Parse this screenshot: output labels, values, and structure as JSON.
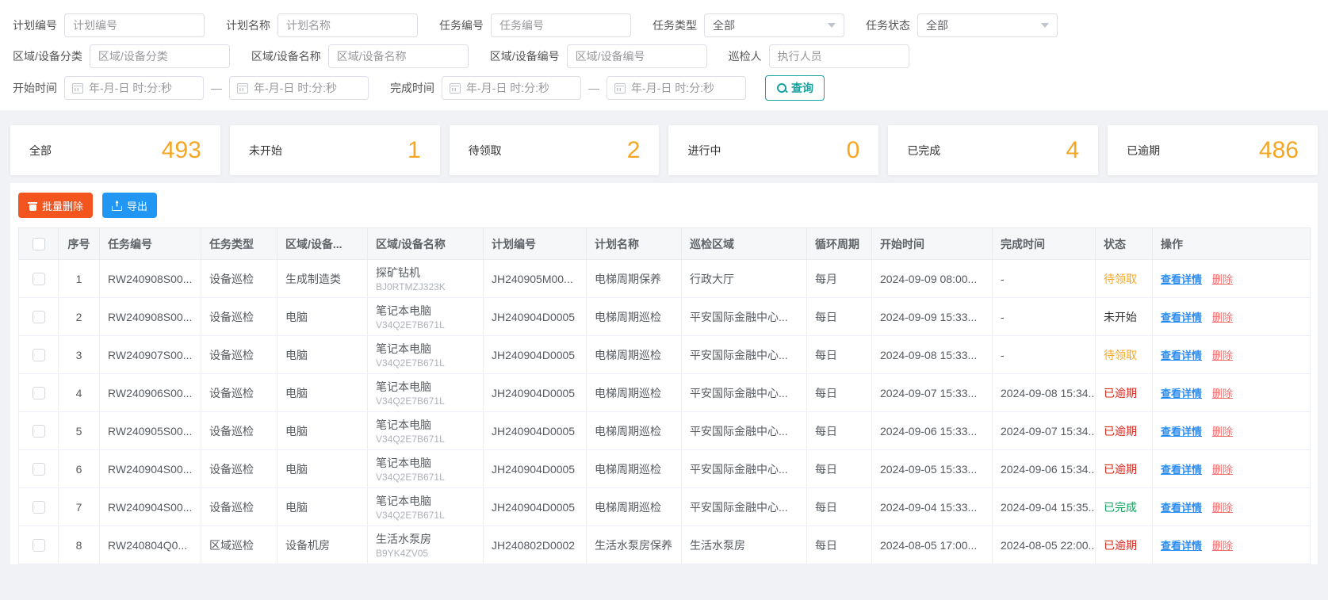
{
  "colors": {
    "accent_teal": "#18a1a0",
    "stat_number_orange": "#f5a623",
    "danger_button": "#f4541d",
    "primary_button": "#2196f3",
    "status_pending": "#f5a623",
    "status_overdue": "#d8281e",
    "status_done": "#11a35c",
    "link_blue": "#2d8cf0",
    "link_delete_red": "#f56c6c"
  },
  "filters": {
    "plan_no": {
      "label": "计划编号",
      "placeholder": "计划编号"
    },
    "plan_name": {
      "label": "计划名称",
      "placeholder": "计划名称"
    },
    "task_no": {
      "label": "任务编号",
      "placeholder": "任务编号"
    },
    "task_type": {
      "label": "任务类型",
      "value": "全部"
    },
    "task_status": {
      "label": "任务状态",
      "value": "全部"
    },
    "dev_cat": {
      "label": "区域/设备分类",
      "placeholder": "区域/设备分类"
    },
    "dev_name": {
      "label": "区域/设备名称",
      "placeholder": "区域/设备名称"
    },
    "dev_no": {
      "label": "区域/设备编号",
      "placeholder": "区域/设备编号"
    },
    "inspector": {
      "label": "巡检人",
      "placeholder": "执行人员"
    },
    "start_time": {
      "label": "开始时间",
      "placeholder": "年-月-日 时:分:秒"
    },
    "end_time": {
      "label": "完成时间",
      "placeholder": "年-月-日 时:分:秒"
    },
    "range_separator": "—",
    "search_button": "查询"
  },
  "stats": [
    {
      "label": "全部",
      "value": "493"
    },
    {
      "label": "未开始",
      "value": "1"
    },
    {
      "label": "待领取",
      "value": "2"
    },
    {
      "label": "进行中",
      "value": "0"
    },
    {
      "label": "已完成",
      "value": "4"
    },
    {
      "label": "已逾期",
      "value": "486"
    }
  ],
  "toolbar": {
    "batch_delete": "批量删除",
    "export": "导出"
  },
  "table": {
    "headers": [
      "",
      "序号",
      "任务编号",
      "任务类型",
      "区域/设备...",
      "区域/设备名称",
      "计划编号",
      "计划名称",
      "巡检区域",
      "循环周期",
      "开始时间",
      "完成时间",
      "状态",
      "操作"
    ],
    "actions": {
      "view": "查看详情",
      "delete": "删除"
    },
    "rows": [
      {
        "seq": "1",
        "task_no": "RW240908S00...",
        "task_type": "设备巡检",
        "dev_cat": "生成制造类",
        "dev_name": "探矿钻机",
        "dev_code": "BJ0RTMZJ323K",
        "plan_no": "JH240905M00...",
        "plan_name": "电梯周期保养",
        "area": "行政大厅",
        "cycle": "每月",
        "start": "2024-09-09 08:00...",
        "end": "-",
        "status": "待领取",
        "status_class": "status st-pending"
      },
      {
        "seq": "2",
        "task_no": "RW240908S00...",
        "task_type": "设备巡检",
        "dev_cat": "电脑",
        "dev_name": "笔记本电脑",
        "dev_code": "V34Q2E7B671L",
        "plan_no": "JH240904D0005",
        "plan_name": "电梯周期巡检",
        "area": "平安国际金融中心...",
        "cycle": "每日",
        "start": "2024-09-09 15:33...",
        "end": "-",
        "status": "未开始",
        "status_class": "status st-default"
      },
      {
        "seq": "3",
        "task_no": "RW240907S00...",
        "task_type": "设备巡检",
        "dev_cat": "电脑",
        "dev_name": "笔记本电脑",
        "dev_code": "V34Q2E7B671L",
        "plan_no": "JH240904D0005",
        "plan_name": "电梯周期巡检",
        "area": "平安国际金融中心...",
        "cycle": "每日",
        "start": "2024-09-08 15:33...",
        "end": "-",
        "status": "待领取",
        "status_class": "status st-pending"
      },
      {
        "seq": "4",
        "task_no": "RW240906S00...",
        "task_type": "设备巡检",
        "dev_cat": "电脑",
        "dev_name": "笔记本电脑",
        "dev_code": "V34Q2E7B671L",
        "plan_no": "JH240904D0005",
        "plan_name": "电梯周期巡检",
        "area": "平安国际金融中心...",
        "cycle": "每日",
        "start": "2024-09-07 15:33...",
        "end": "2024-09-08 15:34...",
        "status": "已逾期",
        "status_class": "status st-overdue"
      },
      {
        "seq": "5",
        "task_no": "RW240905S00...",
        "task_type": "设备巡检",
        "dev_cat": "电脑",
        "dev_name": "笔记本电脑",
        "dev_code": "V34Q2E7B671L",
        "plan_no": "JH240904D0005",
        "plan_name": "电梯周期巡检",
        "area": "平安国际金融中心...",
        "cycle": "每日",
        "start": "2024-09-06 15:33...",
        "end": "2024-09-07 15:34...",
        "status": "已逾期",
        "status_class": "status st-overdue"
      },
      {
        "seq": "6",
        "task_no": "RW240904S00...",
        "task_type": "设备巡检",
        "dev_cat": "电脑",
        "dev_name": "笔记本电脑",
        "dev_code": "V34Q2E7B671L",
        "plan_no": "JH240904D0005",
        "plan_name": "电梯周期巡检",
        "area": "平安国际金融中心...",
        "cycle": "每日",
        "start": "2024-09-05 15:33...",
        "end": "2024-09-06 15:34...",
        "status": "已逾期",
        "status_class": "status st-overdue"
      },
      {
        "seq": "7",
        "task_no": "RW240904S00...",
        "task_type": "设备巡检",
        "dev_cat": "电脑",
        "dev_name": "笔记本电脑",
        "dev_code": "V34Q2E7B671L",
        "plan_no": "JH240904D0005",
        "plan_name": "电梯周期巡检",
        "area": "平安国际金融中心...",
        "cycle": "每日",
        "start": "2024-09-04 15:33...",
        "end": "2024-09-04 15:35...",
        "status": "已完成",
        "status_class": "status st-done"
      },
      {
        "seq": "8",
        "task_no": "RW240804Q0...",
        "task_type": "区域巡检",
        "dev_cat": "设备机房",
        "dev_name": "生活水泵房",
        "dev_code": "B9YK4ZV05",
        "plan_no": "JH240802D0002",
        "plan_name": "生活水泵房保养",
        "area": "生活水泵房",
        "cycle": "每日",
        "start": "2024-08-05 17:00...",
        "end": "2024-08-05 22:00...",
        "status": "已逾期",
        "status_class": "status st-overdue"
      }
    ]
  }
}
